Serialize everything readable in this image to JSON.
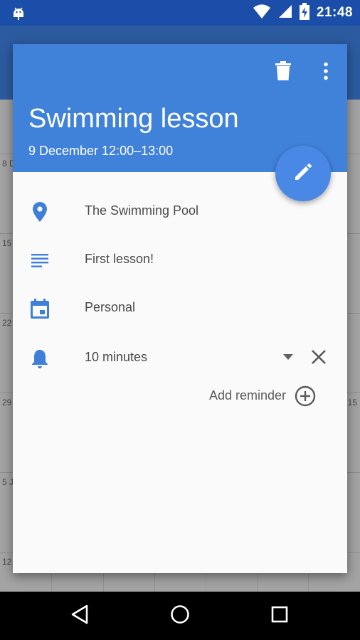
{
  "status_bar": {
    "time": "21:48"
  },
  "event": {
    "title": "Swimming lesson",
    "datetime": "9 December 12:00–13:00",
    "location": "The Swimming Pool",
    "description": "First lesson!",
    "calendar": "Personal",
    "reminder": "10 minutes",
    "add_reminder_label": "Add reminder"
  },
  "background_calendar": {
    "week_labels": [
      "8 D",
      "15",
      "22",
      "29",
      "5 J",
      "12"
    ],
    "right_label": "15"
  },
  "colors": {
    "header": "#4081d9",
    "fab": "#4a88e6",
    "icon_accent": "#3f7fd8",
    "status_bar": "#1a4ea8"
  },
  "icons": {
    "header": [
      "delete-icon",
      "more-vert-icon"
    ],
    "rows": [
      "location-pin-icon",
      "notes-icon",
      "calendar-icon",
      "bell-icon"
    ],
    "fab": "edit-pencil-icon"
  }
}
